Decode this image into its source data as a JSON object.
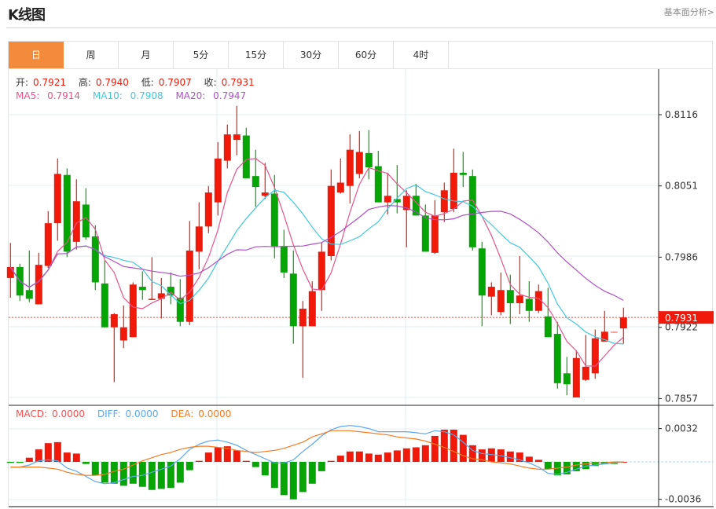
{
  "header": {
    "title": "K线图",
    "link": "基本面分析>"
  },
  "tabs": [
    {
      "label": "日",
      "active": true
    },
    {
      "label": "周"
    },
    {
      "label": "月"
    },
    {
      "label": "5分"
    },
    {
      "label": "15分"
    },
    {
      "label": "30分"
    },
    {
      "label": "60分"
    },
    {
      "label": "4时"
    }
  ],
  "ohlc_legend": {
    "open_label": "开:",
    "open": "0.7921",
    "high_label": "高:",
    "high": "0.7940",
    "low_label": "低:",
    "low": "0.7907",
    "close_label": "收:",
    "close": "0.7931"
  },
  "ma_legend": {
    "ma5_label": "MA5:",
    "ma5": "0.7914",
    "ma10_label": "MA10:",
    "ma10": "0.7908",
    "ma20_label": "MA20:",
    "ma20": "0.7947"
  },
  "macd_legend": {
    "macd_label": "MACD:",
    "macd": "0.0000",
    "diff_label": "DIFF:",
    "diff": "0.0000",
    "dea_label": "DEA:",
    "dea": "0.0000"
  },
  "colors": {
    "up": "#f0190a",
    "down": "#05a505",
    "ma5": "#e8548a",
    "ma10": "#40c8e0",
    "ma20": "#b050c8",
    "diff": "#5aa8f0",
    "dea": "#f57a20",
    "accent": "#f28c3c"
  },
  "chart_data": [
    {
      "type": "candlestick",
      "price_ticks": [
        "0.8116",
        "0.8051",
        "0.7986",
        "0.7922",
        "0.7857"
      ],
      "ylim": [
        0.7857,
        0.8116
      ],
      "last_price": "0.7931",
      "grid": true,
      "ma_periods": [
        5,
        10,
        20
      ],
      "candles_ohlc": [
        [
          0.7967,
          0.7999,
          0.7949,
          0.7977
        ],
        [
          0.7977,
          0.798,
          0.7946,
          0.7951
        ],
        [
          0.7956,
          0.7992,
          0.7945,
          0.7948
        ],
        [
          0.7943,
          0.799,
          0.7943,
          0.7979
        ],
        [
          0.7978,
          0.8028,
          0.7976,
          0.8017
        ],
        [
          0.8017,
          0.8076,
          0.8001,
          0.8062
        ],
        [
          0.8061,
          0.8067,
          0.7986,
          0.7991
        ],
        [
          0.8,
          0.8057,
          0.7993,
          0.8037
        ],
        [
          0.8034,
          0.8049,
          0.8002,
          0.8004
        ],
        [
          0.8005,
          0.8015,
          0.7956,
          0.7963
        ],
        [
          0.7962,
          0.7983,
          0.7922,
          0.7922
        ],
        [
          0.7922,
          0.7935,
          0.7872,
          0.7934
        ],
        [
          0.791,
          0.7942,
          0.7903,
          0.7922
        ],
        [
          0.7913,
          0.7963,
          0.7913,
          0.7961
        ],
        [
          0.7959,
          0.7973,
          0.7947,
          0.7956
        ],
        [
          0.7947,
          0.7986,
          0.7947,
          0.7948
        ],
        [
          0.7948,
          0.7967,
          0.793,
          0.7953
        ],
        [
          0.7959,
          0.7972,
          0.7943,
          0.7951
        ],
        [
          0.7949,
          0.7966,
          0.7923,
          0.7927
        ],
        [
          0.7927,
          0.8019,
          0.7924,
          0.7992
        ],
        [
          0.7991,
          0.8036,
          0.7975,
          0.8014
        ],
        [
          0.8014,
          0.8051,
          0.8008,
          0.8045
        ],
        [
          0.8036,
          0.8091,
          0.8024,
          0.8076
        ],
        [
          0.8074,
          0.8107,
          0.8067,
          0.8098
        ],
        [
          0.8093,
          0.8124,
          0.8079,
          0.8098
        ],
        [
          0.8097,
          0.8104,
          0.8058,
          0.8058
        ],
        [
          0.806,
          0.8084,
          0.8032,
          0.805
        ],
        [
          0.8042,
          0.8072,
          0.8039,
          0.8045
        ],
        [
          0.8044,
          0.8061,
          0.7985,
          0.7996
        ],
        [
          0.7996,
          0.8011,
          0.7967,
          0.7972
        ],
        [
          0.7971,
          0.7992,
          0.7907,
          0.7923
        ],
        [
          0.7923,
          0.7946,
          0.7876,
          0.7939
        ],
        [
          0.7923,
          0.7964,
          0.7923,
          0.7955
        ],
        [
          0.7956,
          0.7999,
          0.7937,
          0.7991
        ],
        [
          0.7987,
          0.8066,
          0.7983,
          0.8051
        ],
        [
          0.8045,
          0.8076,
          0.8044,
          0.8054
        ],
        [
          0.8051,
          0.8098,
          0.8035,
          0.8084
        ],
        [
          0.8062,
          0.8101,
          0.8058,
          0.8082
        ],
        [
          0.8081,
          0.8102,
          0.8057,
          0.8068
        ],
        [
          0.8069,
          0.8083,
          0.8036,
          0.8036
        ],
        [
          0.8036,
          0.8063,
          0.8025,
          0.8042
        ],
        [
          0.8039,
          0.807,
          0.8026,
          0.8036
        ],
        [
          0.8029,
          0.8047,
          0.7995,
          0.8042
        ],
        [
          0.8042,
          0.8053,
          0.8024,
          0.8024
        ],
        [
          0.8024,
          0.8034,
          0.7991,
          0.7991
        ],
        [
          0.799,
          0.8038,
          0.7989,
          0.8024
        ],
        [
          0.8027,
          0.8054,
          0.8018,
          0.8047
        ],
        [
          0.803,
          0.8085,
          0.8027,
          0.8063
        ],
        [
          0.8063,
          0.8082,
          0.805,
          0.8061
        ],
        [
          0.806,
          0.8066,
          0.7992,
          0.7995
        ],
        [
          0.7994,
          0.8,
          0.7923,
          0.7951
        ],
        [
          0.795,
          0.7963,
          0.7933,
          0.7959
        ],
        [
          0.7936,
          0.7972,
          0.7933,
          0.7956
        ],
        [
          0.7956,
          0.797,
          0.7925,
          0.7944
        ],
        [
          0.7944,
          0.7987,
          0.7934,
          0.7951
        ],
        [
          0.7948,
          0.7964,
          0.7927,
          0.7937
        ],
        [
          0.7937,
          0.7961,
          0.7935,
          0.7955
        ],
        [
          0.7932,
          0.7958,
          0.7913,
          0.7913
        ],
        [
          0.7916,
          0.7927,
          0.7866,
          0.7871
        ],
        [
          0.788,
          0.7895,
          0.786,
          0.787
        ],
        [
          0.7858,
          0.7901,
          0.7858,
          0.7894
        ],
        [
          0.7874,
          0.7915,
          0.7873,
          0.7886
        ],
        [
          0.788,
          0.792,
          0.7875,
          0.7912
        ],
        [
          0.7909,
          0.7937,
          0.7909,
          0.7918
        ],
        [
          0.7918,
          0.7918,
          0.7917,
          0.7918
        ],
        [
          0.7921,
          0.794,
          0.7907,
          0.7931
        ]
      ]
    },
    {
      "type": "bar+line",
      "ticks": [
        "0.0032",
        "-0.0036"
      ],
      "ylim": [
        -0.0036,
        0.0032
      ],
      "macd": [
        -0.0001,
        -0.0001,
        0.0004,
        0.0012,
        0.0018,
        0.0019,
        0.0009,
        0.0008,
        -0.0002,
        -0.0013,
        -0.002,
        -0.0021,
        -0.0023,
        -0.0021,
        -0.0024,
        -0.0027,
        -0.0026,
        -0.0025,
        -0.002,
        -0.0008,
        0.0001,
        0.0009,
        0.0014,
        0.0015,
        0.0011,
        0.0001,
        -0.0005,
        -0.0013,
        -0.0025,
        -0.0032,
        -0.0036,
        -0.0029,
        -0.0021,
        -0.0009,
        0.0001,
        0.0006,
        0.001,
        0.001,
        0.0008,
        0.0007,
        0.0009,
        0.0011,
        0.0013,
        0.0014,
        0.0016,
        0.0025,
        0.0031,
        0.0031,
        0.0026,
        0.0016,
        0.0012,
        0.0013,
        0.0012,
        0.001,
        0.0009,
        0.0005,
        0.0002,
        -0.0007,
        -0.0013,
        -0.0012,
        -0.0009,
        -0.0007,
        -0.0004,
        -0.0002,
        -0.0002,
        0.0
      ],
      "diff": [
        -0.0005,
        -0.0005,
        -0.0003,
        0.0001,
        0.0002,
        0.0001,
        -0.0006,
        -0.0009,
        -0.0014,
        -0.0019,
        -0.0021,
        -0.002,
        -0.0017,
        -0.0014,
        -0.0013,
        -0.001,
        -0.0007,
        -0.0004,
        0.0003,
        0.0012,
        0.0017,
        0.002,
        0.0021,
        0.0019,
        0.0016,
        0.0011,
        0.0007,
        0.0003,
        -0.0001,
        -0.0001,
        0.0002,
        0.001,
        0.0017,
        0.0025,
        0.0031,
        0.0034,
        0.0035,
        0.0034,
        0.0032,
        0.0029,
        0.0029,
        0.0029,
        0.0029,
        0.0028,
        0.0027,
        0.003,
        0.0029,
        0.0026,
        0.0019,
        0.0011,
        0.0008,
        0.0007,
        0.0006,
        0.0004,
        0.0002,
        -0.0001,
        -0.0005,
        -0.0011,
        -0.0012,
        -0.001,
        -0.0007,
        -0.0004,
        -0.0003,
        -0.0002,
        -0.0001,
        0.0
      ],
      "dea": [
        -0.0005,
        -0.0005,
        -0.0005,
        -0.0005,
        -0.0006,
        -0.0007,
        -0.001,
        -0.0012,
        -0.0013,
        -0.0013,
        -0.0012,
        -0.0009,
        -0.0007,
        -0.0003,
        0.0001,
        0.0004,
        0.0007,
        0.0009,
        0.0012,
        0.0014,
        0.0015,
        0.0015,
        0.0014,
        0.0013,
        0.0011,
        0.001,
        0.0009,
        0.001,
        0.0011,
        0.0013,
        0.0016,
        0.0019,
        0.0024,
        0.0027,
        0.003,
        0.003,
        0.003,
        0.0029,
        0.0028,
        0.0027,
        0.0026,
        0.0024,
        0.0023,
        0.0022,
        0.002,
        0.0017,
        0.0014,
        0.001,
        0.0006,
        0.0003,
        0.0002,
        0.0,
        -0.0001,
        -0.0002,
        -0.0004,
        -0.0006,
        -0.0007,
        -0.0007,
        -0.0006,
        -0.0005,
        -0.0003,
        -0.0002,
        -0.0001,
        -0.0001,
        0.0,
        0.0
      ]
    }
  ]
}
